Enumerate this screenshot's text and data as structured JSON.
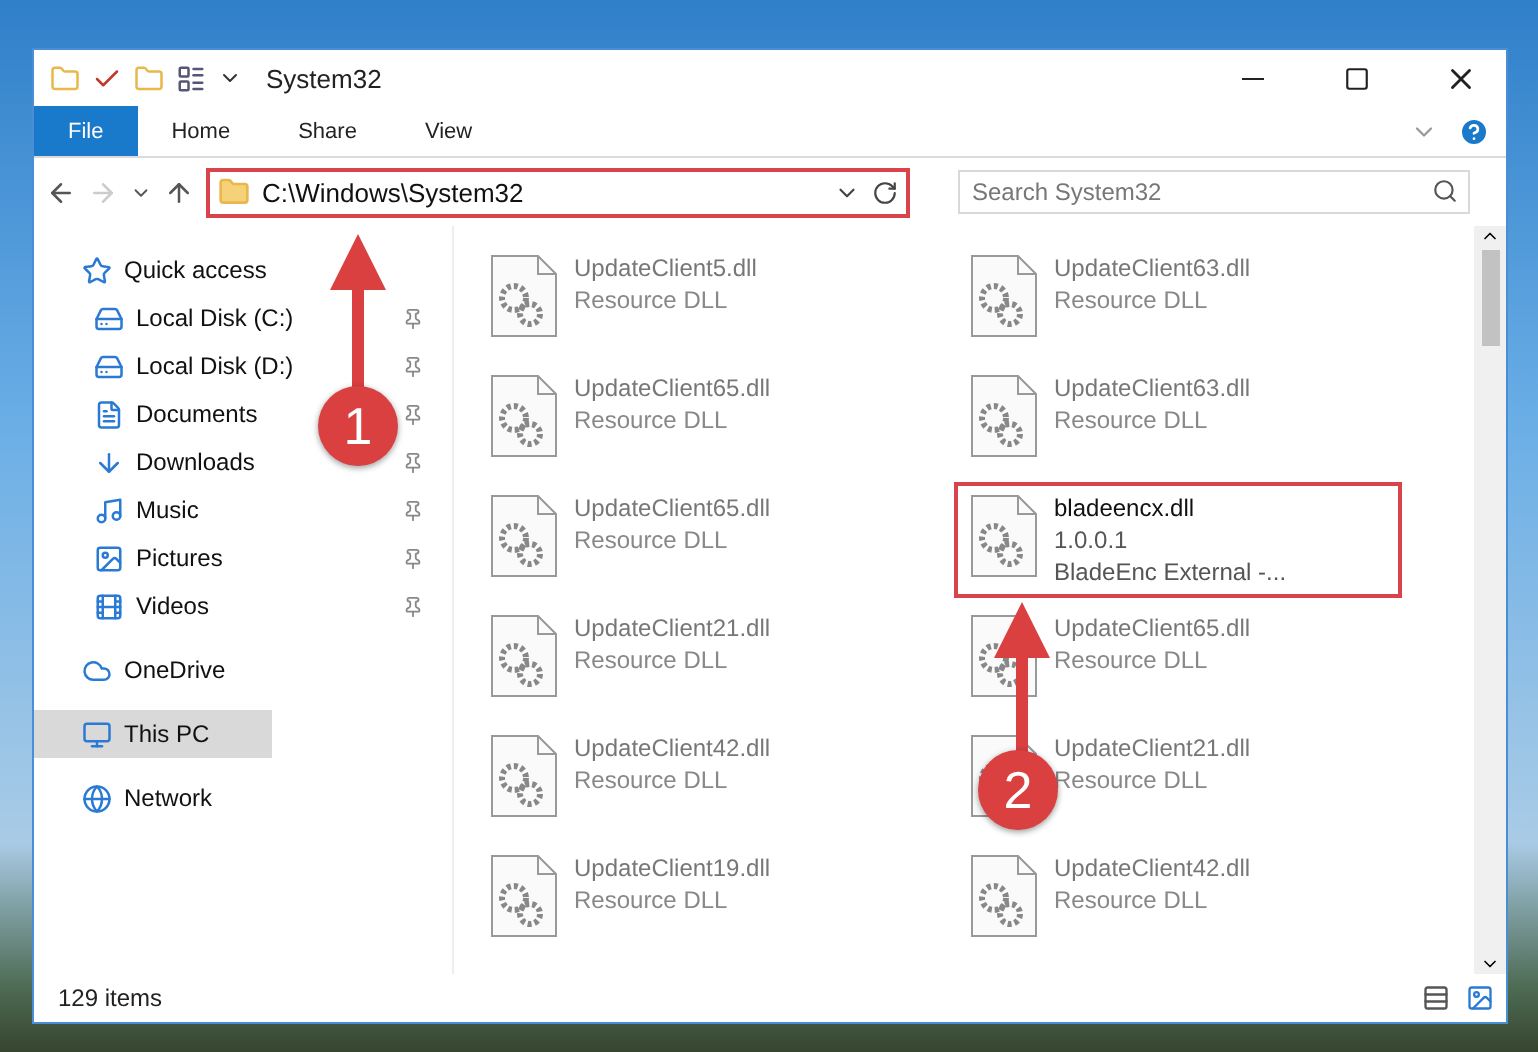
{
  "window": {
    "title": "System32"
  },
  "ribbon_tabs": [
    {
      "label": "File",
      "selected": true
    },
    {
      "label": "Home",
      "selected": false
    },
    {
      "label": "Share",
      "selected": false
    },
    {
      "label": "View",
      "selected": false
    }
  ],
  "address": {
    "path": "C:\\Windows\\System32",
    "highlighted": true
  },
  "search": {
    "placeholder": "Search System32"
  },
  "nav": [
    {
      "label": "Quick access",
      "selected": false,
      "children": [
        {
          "label": "Local Disk (C:)",
          "pinned": true,
          "selected": false
        },
        {
          "label": "Local Disk (D:)",
          "pinned": true,
          "selected": false
        },
        {
          "label": "Documents",
          "pinned": true,
          "selected": false
        },
        {
          "label": "Downloads",
          "pinned": true,
          "selected": false
        },
        {
          "label": "Music",
          "pinned": true,
          "selected": false
        },
        {
          "label": "Pictures",
          "pinned": true,
          "selected": false
        },
        {
          "label": "Videos",
          "pinned": true,
          "selected": false
        }
      ]
    },
    {
      "label": "OneDrive",
      "selected": false
    },
    {
      "label": "This PC",
      "selected": true
    },
    {
      "label": "Network",
      "selected": false
    }
  ],
  "files": [
    {
      "name": "UpdateClient5.dll",
      "lines": [
        "Resource DLL"
      ],
      "highlighted": false
    },
    {
      "name": "UpdateClient63.dll",
      "lines": [
        "Resource DLL"
      ],
      "highlighted": false
    },
    {
      "name": "UpdateClient65.dll",
      "lines": [
        "Resource DLL"
      ],
      "highlighted": false
    },
    {
      "name": "UpdateClient63.dll",
      "lines": [
        "Resource DLL"
      ],
      "highlighted": false
    },
    {
      "name": "UpdateClient65.dll",
      "lines": [
        "Resource DLL"
      ],
      "highlighted": false
    },
    {
      "name": "bladeencx.dll",
      "lines": [
        "1.0.0.1",
        "BladeEnc External -..."
      ],
      "highlighted": true
    },
    {
      "name": "UpdateClient21.dll",
      "lines": [
        "Resource DLL"
      ],
      "highlighted": false
    },
    {
      "name": "UpdateClient65.dll",
      "lines": [
        "Resource DLL"
      ],
      "highlighted": false
    },
    {
      "name": "UpdateClient42.dll",
      "lines": [
        "Resource DLL"
      ],
      "highlighted": false
    },
    {
      "name": "UpdateClient21.dll",
      "lines": [
        "Resource DLL"
      ],
      "highlighted": false
    },
    {
      "name": "UpdateClient19.dll",
      "lines": [
        "Resource DLL"
      ],
      "highlighted": false
    },
    {
      "name": "UpdateClient42.dll",
      "lines": [
        "Resource DLL"
      ],
      "highlighted": false
    }
  ],
  "status_bar": {
    "item_count": "129 items"
  },
  "callouts": [
    {
      "label": "1"
    },
    {
      "label": "2"
    }
  ]
}
